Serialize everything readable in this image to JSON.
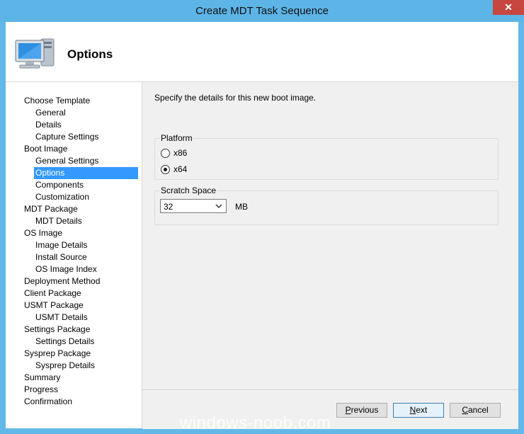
{
  "window": {
    "title": "Create MDT Task Sequence",
    "close_glyph": "✕"
  },
  "header": {
    "title": "Options",
    "icon": "computer-icon"
  },
  "nav": [
    {
      "label": "Choose Template",
      "level": 0
    },
    {
      "label": "General",
      "level": 1
    },
    {
      "label": "Details",
      "level": 1
    },
    {
      "label": "Capture Settings",
      "level": 1
    },
    {
      "label": "Boot Image",
      "level": 0
    },
    {
      "label": "General Settings",
      "level": 1
    },
    {
      "label": "Options",
      "level": 1,
      "active": true
    },
    {
      "label": "Components",
      "level": 1
    },
    {
      "label": "Customization",
      "level": 1
    },
    {
      "label": "MDT Package",
      "level": 0
    },
    {
      "label": "MDT Details",
      "level": 1
    },
    {
      "label": "OS Image",
      "level": 0
    },
    {
      "label": "Image Details",
      "level": 1
    },
    {
      "label": "Install Source",
      "level": 1
    },
    {
      "label": "OS Image Index",
      "level": 1
    },
    {
      "label": "Deployment Method",
      "level": 0
    },
    {
      "label": "Client Package",
      "level": 0
    },
    {
      "label": "USMT Package",
      "level": 0
    },
    {
      "label": "USMT Details",
      "level": 1
    },
    {
      "label": "Settings Package",
      "level": 0
    },
    {
      "label": "Settings Details",
      "level": 1
    },
    {
      "label": "Sysprep Package",
      "level": 0
    },
    {
      "label": "Sysprep Details",
      "level": 1
    },
    {
      "label": "Summary",
      "level": 0
    },
    {
      "label": "Progress",
      "level": 0
    },
    {
      "label": "Confirmation",
      "level": 0
    }
  ],
  "content": {
    "description": "Specify the details for this new boot image.",
    "platform": {
      "label": "Platform",
      "options": [
        {
          "label": "x86",
          "checked": false
        },
        {
          "label": "x64",
          "checked": true
        }
      ]
    },
    "scratch": {
      "label": "Scratch Space",
      "value": "32",
      "unit": "MB"
    }
  },
  "buttons": {
    "previous": "Previous",
    "next": "Next",
    "cancel": "Cancel"
  },
  "watermark": "windows-noob.com",
  "colors": {
    "accent": "#3399ff",
    "titlebar": "#5db4e6",
    "close": "#c7463f"
  }
}
